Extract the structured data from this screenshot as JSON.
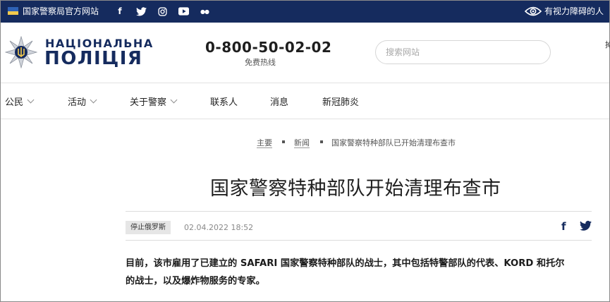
{
  "topbar": {
    "site_label": "国家警察局官方网站",
    "social": [
      {
        "icon": "facebook-icon",
        "glyph": "f"
      },
      {
        "icon": "twitter-icon",
        "glyph": ""
      },
      {
        "icon": "instagram-icon",
        "glyph": ""
      },
      {
        "icon": "youtube-icon",
        "glyph": ""
      },
      {
        "icon": "flickr-icon",
        "glyph": "●●"
      }
    ],
    "accessibility_label": "有视力障碍的人"
  },
  "header": {
    "brand_line1": "НАЦІОНАЛЬНА",
    "brand_line2": "ПОЛІЦІЯ",
    "phone": "0-800-50-02-02",
    "phone_caption": "免费热线",
    "search_placeholder": "搜索网站",
    "edge_text": "掉"
  },
  "nav": [
    {
      "label": "公民",
      "has_dropdown": true
    },
    {
      "label": "活动",
      "has_dropdown": true
    },
    {
      "label": "关于警察",
      "has_dropdown": true
    },
    {
      "label": "联系人",
      "has_dropdown": false
    },
    {
      "label": "消息",
      "has_dropdown": false
    },
    {
      "label": "新冠肺炎",
      "has_dropdown": false
    }
  ],
  "breadcrumb": [
    "主要",
    "新闻",
    "国家警察特种部队已开始清理布查市"
  ],
  "article": {
    "title": "国家警察特种部队开始清理布查市",
    "tag": "停止俄罗斯",
    "date": "02.04.2022 18:52",
    "lead_line1": "目前，该市雇用了已建立的 SAFARI 国家警察特种部队的战士，其中包括特警部队的代表、KORD 和托尔",
    "lead_line2": "的战士，以及爆炸物服务的专家。"
  },
  "colors": {
    "brand_navy": "#152b5e",
    "flag_blue": "#2f62b6",
    "flag_yellow": "#f2c94c"
  }
}
